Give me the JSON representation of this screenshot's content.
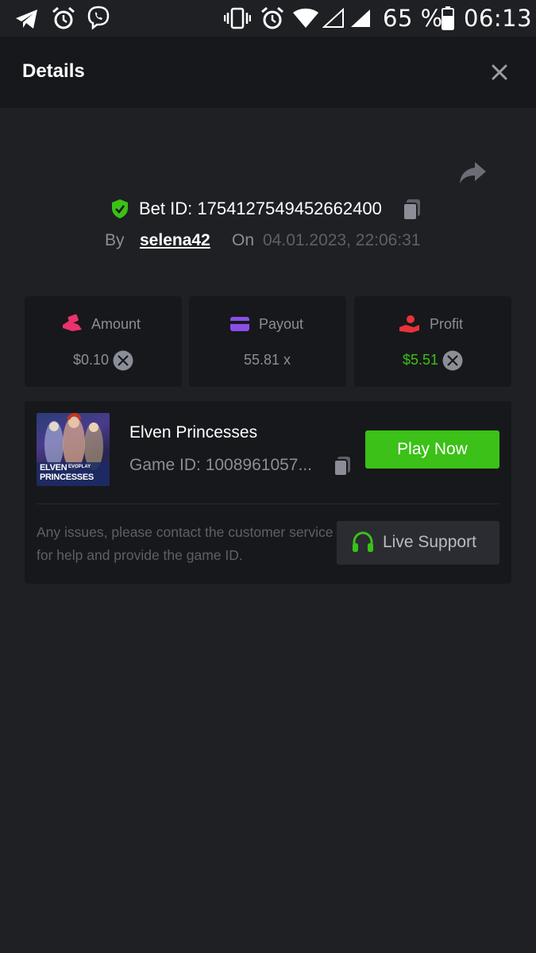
{
  "status_bar": {
    "battery": "65 %",
    "time": "06:13"
  },
  "header": {
    "title": "Details"
  },
  "bet": {
    "bet_id": "Bet ID: 1754127549452662400",
    "by_label": "By",
    "username": "selena42",
    "on_label": "On",
    "datetime": "04.01.2023, 22:06:31"
  },
  "stats": [
    {
      "label": "Amount",
      "value": "$0.10",
      "icon": "coins-hand-icon",
      "value_color": "#8b8e96"
    },
    {
      "label": "Payout",
      "value": "55.81 x",
      "icon": "card-icon",
      "value_color": "#8b8e96"
    },
    {
      "label": "Profit",
      "value": "$5.51",
      "icon": "money-hand-icon",
      "value_color": "#3bc117"
    }
  ],
  "game": {
    "name": "Elven Princesses",
    "game_id": "Game ID: 1008961057...",
    "thumb_title_1": "ELVEN",
    "thumb_title_2": "PRINCESSES",
    "thumb_brand": "EVOPLAY",
    "play_label": "Play Now",
    "help_text": "Any issues, please contact the customer service for help and provide the game ID.",
    "support_label": "Live Support"
  },
  "colors": {
    "accent_green": "#3bc117",
    "background": "#1f2024",
    "panel": "#17181b"
  }
}
